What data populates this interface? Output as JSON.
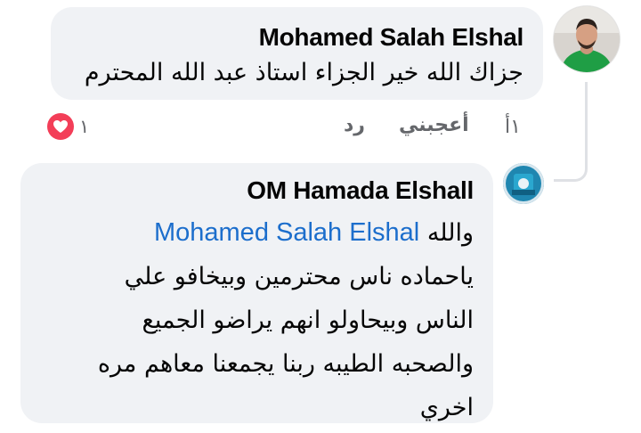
{
  "comment": {
    "author": "Mohamed Salah Elshal",
    "text": "جزاك الله خير الجزاء استاذ عبد الله المحترم",
    "time": "١أ",
    "like_label": "أعجبني",
    "reply_label": "رد",
    "reaction_count": "١",
    "reaction_icon": "heart-icon",
    "reaction_color": "#f33e58"
  },
  "reply": {
    "author": "OM Hamada Elshall",
    "mention": "Mohamed Salah Elshal",
    "lines": [
      "والله",
      "ياحماده ناس محترمين وبيخافو  علي",
      "الناس وبيحاولو انهم يراضو الجميع",
      "والصحبه الطيبه ربنا يجمعنا معاهم مره",
      "اخري"
    ]
  },
  "colors": {
    "bubble": "#f0f2f5",
    "mention": "#1c6ecc",
    "meta_text": "#65676b",
    "thread_line": "#dfe1e5"
  }
}
